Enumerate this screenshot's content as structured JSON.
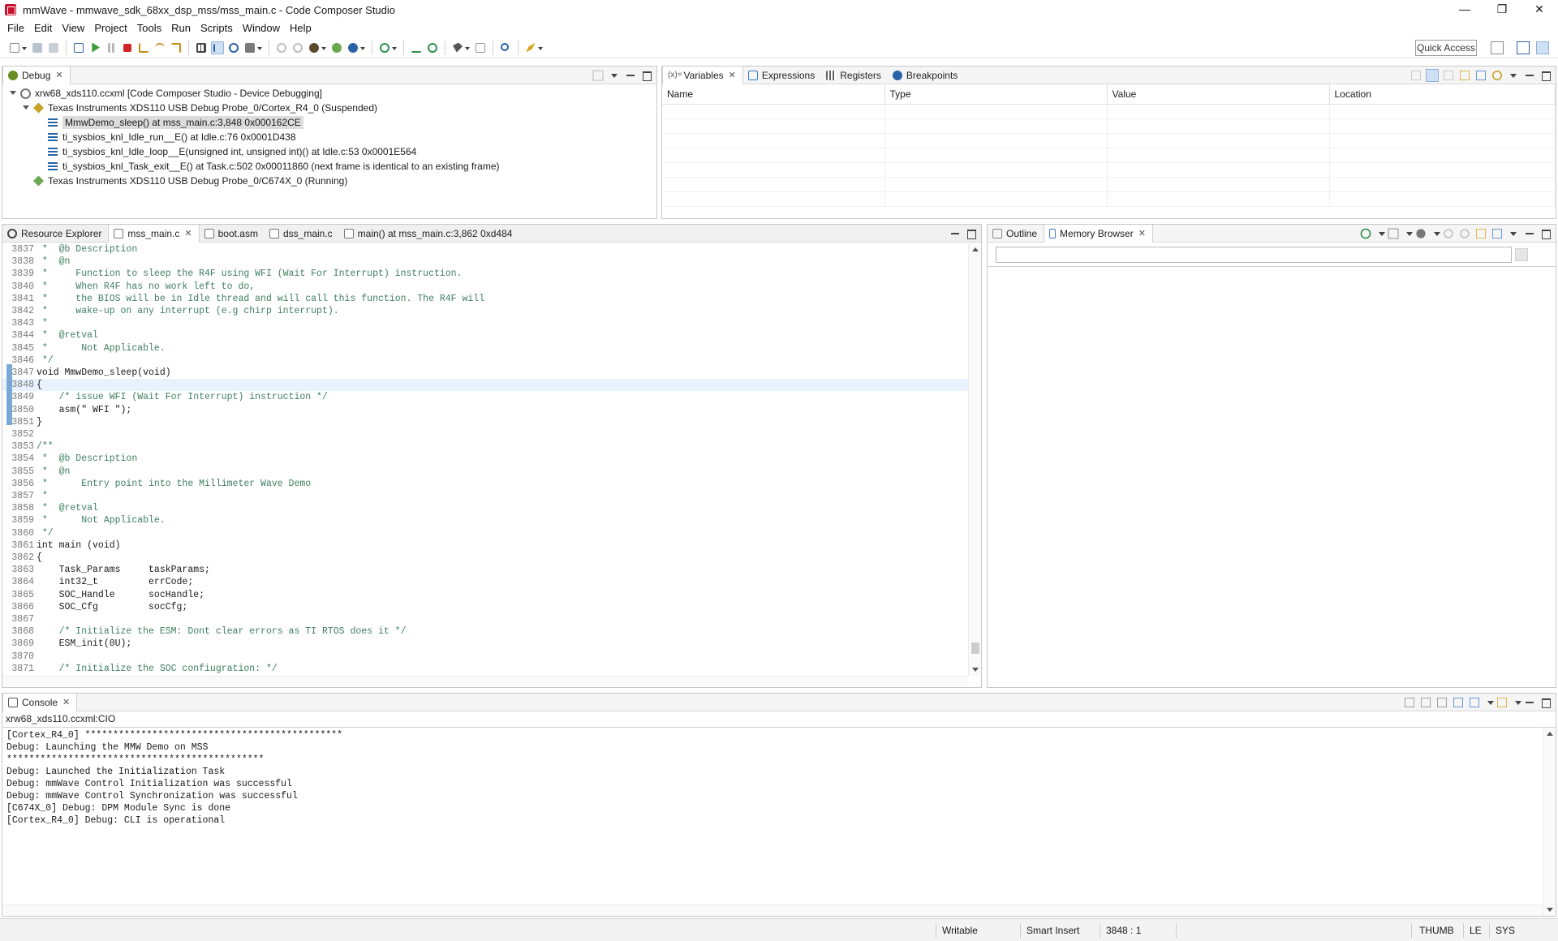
{
  "window": {
    "title": "mmWave - mmwave_sdk_68xx_dsp_mss/mss_main.c - Code Composer Studio",
    "minimize": "—",
    "restore": "❐",
    "close": "✕"
  },
  "menu": [
    "File",
    "Edit",
    "View",
    "Project",
    "Tools",
    "Run",
    "Scripts",
    "Window",
    "Help"
  ],
  "toolbar": {
    "quick_access": "Quick Access"
  },
  "debug_view": {
    "tab": "Debug",
    "tree": [
      {
        "label": "xrw68_xds110.ccxml [Code Composer Studio - Device Debugging]",
        "level": 0,
        "icon": "launch-config-icon"
      },
      {
        "label": "Texas Instruments XDS110 USB Debug Probe_0/Cortex_R4_0 (Suspended)",
        "level": 1,
        "icon": "suspended-thread-icon"
      },
      {
        "label": "MmwDemo_sleep() at mss_main.c:3,848 0x000162CE",
        "level": 2,
        "icon": "stack-frame-icon",
        "selected": true
      },
      {
        "label": "ti_sysbios_knl_Idle_run__E() at Idle.c:76 0x0001D438",
        "level": 2,
        "icon": "stack-frame-icon"
      },
      {
        "label": "ti_sysbios_knl_Idle_loop__E(unsigned int, unsigned int)() at Idle.c:53 0x0001E564",
        "level": 2,
        "icon": "stack-frame-icon"
      },
      {
        "label": "ti_sysbios_knl_Task_exit__E() at Task.c:502 0x00011860  (next frame is identical to an existing frame)",
        "level": 2,
        "icon": "stack-frame-icon"
      },
      {
        "label": "Texas Instruments XDS110 USB Debug Probe_0/C674X_0 (Running)",
        "level": 1,
        "icon": "running-thread-icon"
      }
    ]
  },
  "variables_view": {
    "tabs": [
      "Variables",
      "Expressions",
      "Registers",
      "Breakpoints"
    ],
    "tab_prefix": "(x)=",
    "columns": [
      "Name",
      "Type",
      "Value",
      "Location"
    ]
  },
  "editor": {
    "tabs": [
      "Resource Explorer",
      "mss_main.c",
      "boot.asm",
      "dss_main.c",
      "main() at mss_main.c:3,862 0xd484"
    ],
    "active_tab": 1,
    "lines": [
      {
        "n": "3837",
        "t": " *  @b Description",
        "c": "cmt"
      },
      {
        "n": "3838",
        "t": " *  @n",
        "c": "cmt"
      },
      {
        "n": "3839",
        "t": " *     Function to sleep the R4F using WFI (Wait For Interrupt) instruction.",
        "c": "cmt"
      },
      {
        "n": "3840",
        "t": " *     When R4F has no work left to do,",
        "c": "cmt"
      },
      {
        "n": "3841",
        "t": " *     the BIOS will be in Idle thread and will call this function. The R4F will",
        "c": "cmt"
      },
      {
        "n": "3842",
        "t": " *     wake-up on any interrupt (e.g chirp interrupt).",
        "c": "cmt"
      },
      {
        "n": "3843",
        "t": " *",
        "c": "cmt"
      },
      {
        "n": "3844",
        "t": " *  @retval",
        "c": "cmt"
      },
      {
        "n": "3845",
        "t": " *      Not Applicable.",
        "c": "cmt"
      },
      {
        "n": "3846",
        "t": " */",
        "c": "cmt"
      },
      {
        "n": "3847",
        "t": "void MmwDemo_sleep(void)",
        "c": "kw"
      },
      {
        "n": "3848",
        "t": "{",
        "c": "kw",
        "current": true
      },
      {
        "n": "3849",
        "t": "    /* issue WFI (Wait For Interrupt) instruction */",
        "c": "cmt"
      },
      {
        "n": "3850",
        "t": "    asm(\" WFI \");",
        "c": "kw"
      },
      {
        "n": "3851",
        "t": "}",
        "c": "kw"
      },
      {
        "n": "3852",
        "t": "",
        "c": "kw"
      },
      {
        "n": "3853",
        "t": "/**",
        "c": "cmt"
      },
      {
        "n": "3854",
        "t": " *  @b Description",
        "c": "cmt"
      },
      {
        "n": "3855",
        "t": " *  @n",
        "c": "cmt"
      },
      {
        "n": "3856",
        "t": " *      Entry point into the Millimeter Wave Demo",
        "c": "cmt"
      },
      {
        "n": "3857",
        "t": " *",
        "c": "cmt"
      },
      {
        "n": "3858",
        "t": " *  @retval",
        "c": "cmt"
      },
      {
        "n": "3859",
        "t": " *      Not Applicable.",
        "c": "cmt"
      },
      {
        "n": "3860",
        "t": " */",
        "c": "cmt"
      },
      {
        "n": "3861",
        "t": "int main (void)",
        "c": "kw"
      },
      {
        "n": "3862",
        "t": "{",
        "c": "kw"
      },
      {
        "n": "3863",
        "t": "    Task_Params     taskParams;",
        "c": "kw"
      },
      {
        "n": "3864",
        "t": "    int32_t         errCode;",
        "c": "kw"
      },
      {
        "n": "3865",
        "t": "    SOC_Handle      socHandle;",
        "c": "kw"
      },
      {
        "n": "3866",
        "t": "    SOC_Cfg         socCfg;",
        "c": "kw"
      },
      {
        "n": "3867",
        "t": "",
        "c": "kw"
      },
      {
        "n": "3868",
        "t": "    /* Initialize the ESM: Dont clear errors as TI RTOS does it */",
        "c": "cmt"
      },
      {
        "n": "3869",
        "t": "    ESM_init(0U);",
        "c": "kw"
      },
      {
        "n": "3870",
        "t": "",
        "c": "kw"
      },
      {
        "n": "3871",
        "t": "    /* Initialize the SOC confiugration: */",
        "c": "cmt"
      }
    ]
  },
  "outline_view": {
    "tabs": [
      "Outline",
      "Memory Browser"
    ],
    "address_value": ""
  },
  "console_view": {
    "tab": "Console",
    "subtitle": "xrw68_xds110.ccxml:CIO",
    "lines": [
      "[Cortex_R4_0] **********************************************",
      "Debug: Launching the MMW Demo on MSS",
      "**********************************************",
      "Debug: Launched the Initialization Task",
      "Debug: mmWave Control Initialization was successful",
      "Debug: mmWave Control Synchronization was successful",
      "[C674X_0] Debug: DPM Module Sync is done",
      "[Cortex_R4_0] Debug: CLI is operational"
    ]
  },
  "status_bar": {
    "writable": "Writable",
    "insert_mode": "Smart Insert",
    "position": "3848 : 1",
    "isa": "THUMB",
    "endian": "LE",
    "mode": "SYS"
  }
}
